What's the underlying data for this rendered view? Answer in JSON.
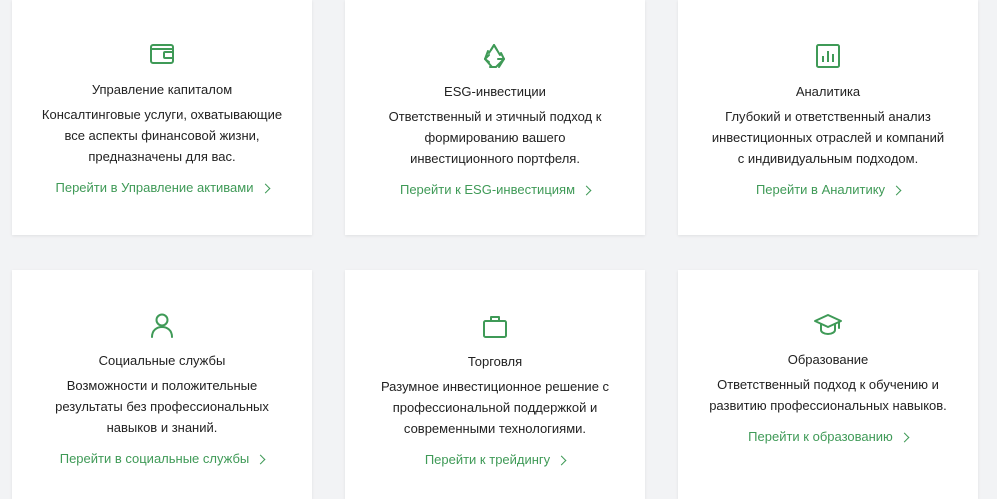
{
  "accent_color": "#3f9a57",
  "cards": [
    {
      "icon": "wallet-icon",
      "title": "Управление капиталом",
      "description": "Консалтинговые услуги, охватывающие\nвсе аспекты финансовой жизни,\nпредназначены для вас.",
      "link": "Перейти в Управление активами"
    },
    {
      "icon": "recycle-icon",
      "title": "ESG-инвестиции",
      "description": "Ответственный и этичный подход к\nформированию вашего\nинвестиционного портфеля.",
      "link": "Перейти к ESG-инвестициям"
    },
    {
      "icon": "bar-chart-icon",
      "title": "Аналитика",
      "description": "Глубокий и ответственный анализ\nинвестиционных отраслей и компаний\nс индивидуальным подходом.",
      "link": "Перейти в Аналитику"
    },
    {
      "icon": "user-icon",
      "title": "Социальные службы",
      "description": "Возможности и положительные\nрезультаты без профессиональных\nнавыков и знаний.",
      "link": "Перейти в социальные службы"
    },
    {
      "icon": "briefcase-icon",
      "title": "Торговля",
      "description": "Разумное инвестиционное решение с\nпрофессиональной поддержкой и\nсовременными технологиями.",
      "link": "Перейти к трейдингу"
    },
    {
      "icon": "graduation-cap-icon",
      "title": "Образование",
      "description": "Ответственный подход к обучению и\nразвитию профессиональных навыков.",
      "link": "Перейти к образованию"
    }
  ]
}
